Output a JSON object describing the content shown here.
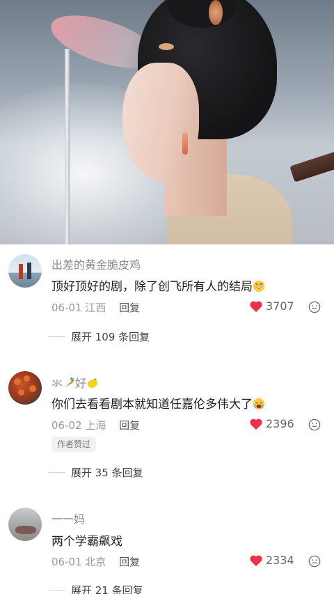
{
  "video": {
    "colors": {
      "sky": "#9aa5b1",
      "hair": "#141416",
      "robe": "#dccab2"
    }
  },
  "comments": [
    {
      "username": "出差的黄金脆皮鸡",
      "text": "顶好顶好的剧，除了创飞所有人的结局",
      "text_emoji": "grinning-sweat-emoji",
      "date": "06-01",
      "location": "江西",
      "reply_label": "回复",
      "likes": "3707",
      "expand": "展开 109 条回复",
      "avatar": "avatar-beach-couple"
    },
    {
      "username_parts": [
        "氺",
        "好"
      ],
      "username_emojis": [
        "carrot-emoji",
        "lemon-emoji"
      ],
      "text": "你们去看看剧本就知道任嘉伦多伟大了",
      "text_emoji": "crying-emoji",
      "date": "06-02",
      "location": "上海",
      "reply_label": "回复",
      "likes": "2396",
      "badge": "作者赞过",
      "expand": "展开 35 条回复",
      "avatar": "avatar-persimmons"
    },
    {
      "username": "一一妈",
      "text": "两个学霸飙戏",
      "date": "06-01",
      "location": "北京",
      "reply_label": "回复",
      "likes": "2334",
      "expand": "展开 21 条回复",
      "avatar": "avatar-landscape"
    }
  ],
  "colors": {
    "heart": "#f0304a",
    "meta": "#999999",
    "username": "#8a8a8a"
  }
}
